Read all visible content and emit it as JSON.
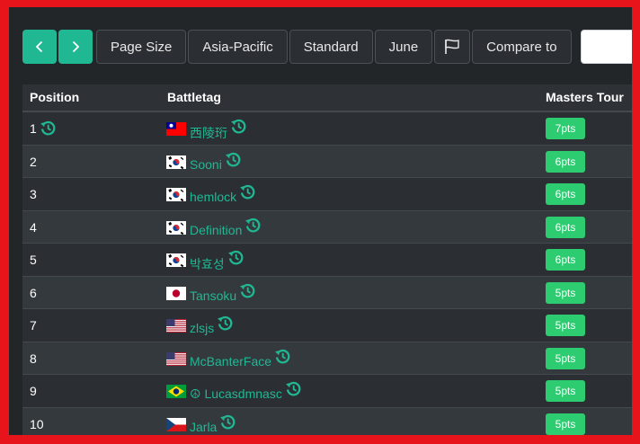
{
  "toolbar": {
    "buttons": [
      "Page Size",
      "Asia-Pacific",
      "Standard",
      "June"
    ],
    "compare_label": "Compare to",
    "compare_value": ""
  },
  "table": {
    "headers": [
      "Position",
      "Battletag",
      "Masters Tour"
    ],
    "rows": [
      {
        "position": "1",
        "flag": "taiwan",
        "name": "西陵珩",
        "points": "7pts"
      },
      {
        "position": "2",
        "flag": "south-korea",
        "name": "Sooni",
        "points": "6pts"
      },
      {
        "position": "3",
        "flag": "south-korea",
        "name": "hemlock",
        "points": "6pts"
      },
      {
        "position": "4",
        "flag": "south-korea",
        "name": "Definition",
        "points": "6pts"
      },
      {
        "position": "5",
        "flag": "south-korea",
        "name": "박효성",
        "points": "6pts"
      },
      {
        "position": "6",
        "flag": "japan",
        "name": "Tansoku",
        "points": "5pts"
      },
      {
        "position": "7",
        "flag": "usa",
        "name": "zlsjs",
        "points": "5pts"
      },
      {
        "position": "8",
        "flag": "usa",
        "name": "McBanterFace",
        "points": "5pts"
      },
      {
        "position": "9",
        "flag": "brazil",
        "name": "☮ Lucasdmnasc",
        "points": "5pts"
      },
      {
        "position": "10",
        "flag": "czechia",
        "name": "Jarla",
        "points": "5pts"
      }
    ]
  },
  "colors": {
    "accent": "#20b893",
    "points_badge": "#2ecc71",
    "frame_border": "#e8141c",
    "background": "#222629"
  }
}
